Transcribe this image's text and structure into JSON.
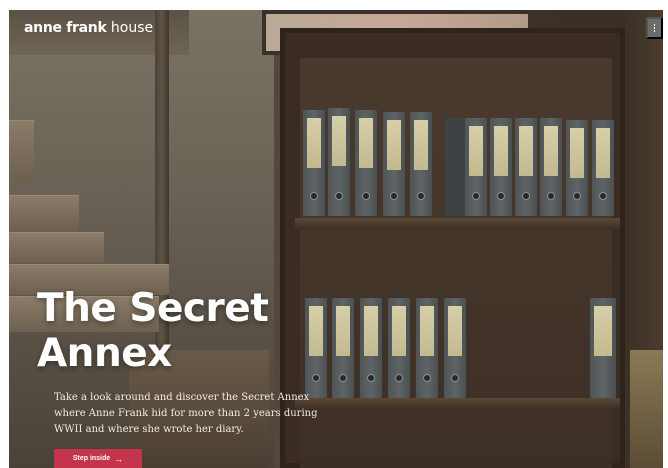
{
  "header": {
    "logo_bold": "anne frank",
    "logo_light": " house",
    "menu_icon": "hamburger-icon"
  },
  "hero": {
    "title_line1": "The Secret",
    "title_line2": "Annex",
    "description": "Take a look around and discover the Secret Annex where Anne Frank hid for more than 2 years during WWII and where she wrote her diary.",
    "cta_label": "Step inside",
    "cta_icon": "arrow-right-icon"
  },
  "colors": {
    "accent": "#c4344a",
    "menu_bg": "#6c6c6c"
  }
}
